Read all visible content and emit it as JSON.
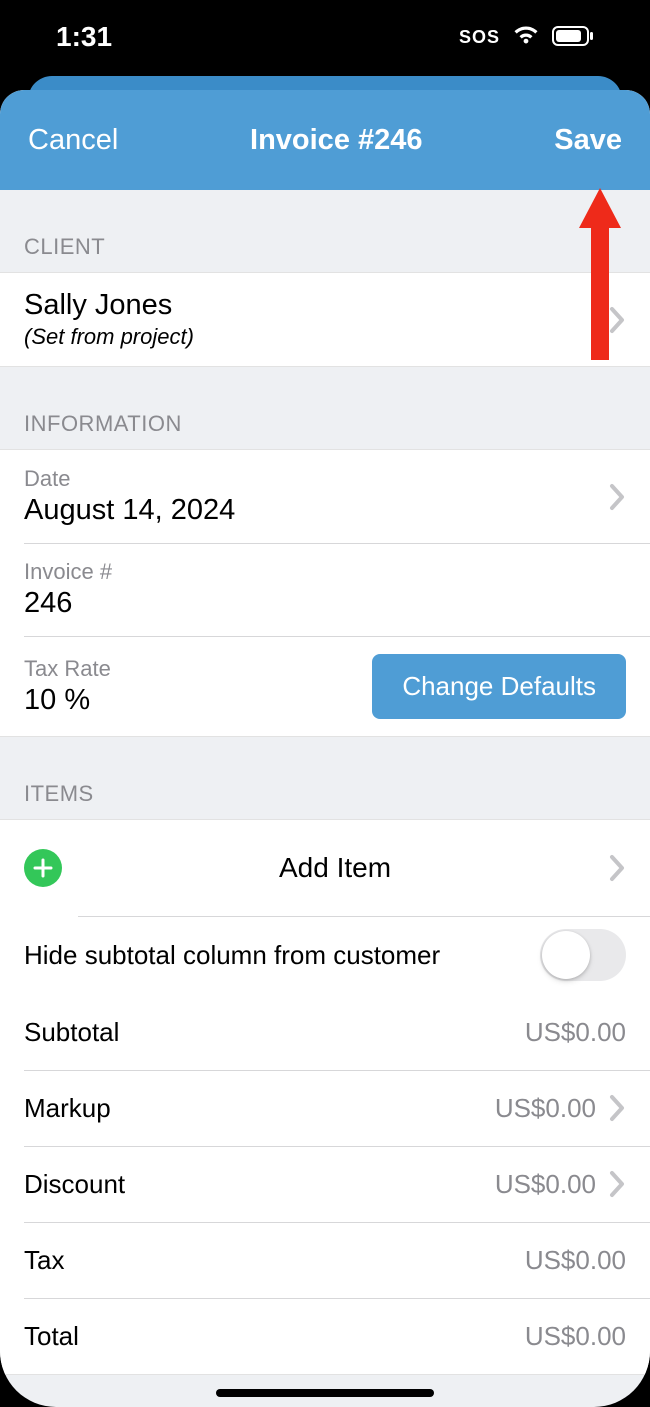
{
  "status": {
    "time": "1:31",
    "sos": "SOS"
  },
  "nav": {
    "cancel": "Cancel",
    "title": "Invoice #246",
    "save": "Save"
  },
  "client": {
    "header": "CLIENT",
    "name": "Sally Jones",
    "sub": "(Set from project)"
  },
  "info": {
    "header": "INFORMATION",
    "date_label": "Date",
    "date_value": "August 14, 2024",
    "num_label": "Invoice #",
    "num_value": "246",
    "tax_label": "Tax Rate",
    "tax_value": "10 %",
    "defaults_btn": "Change Defaults"
  },
  "items": {
    "header": "ITEMS",
    "add_label": "Add Item",
    "hide_subtotal_label": "Hide subtotal column from customer",
    "hide_subtotal_on": false,
    "rows": [
      {
        "label": "Subtotal",
        "amount": "US$0.00",
        "chev": false
      },
      {
        "label": "Markup",
        "amount": "US$0.00",
        "chev": true
      },
      {
        "label": "Discount",
        "amount": "US$0.00",
        "chev": true
      },
      {
        "label": "Tax",
        "amount": "US$0.00",
        "chev": false
      },
      {
        "label": "Total",
        "amount": "US$0.00",
        "chev": false
      }
    ]
  },
  "colors": {
    "accent": "#4f9dd5",
    "arrow": "#ee2a1a"
  }
}
